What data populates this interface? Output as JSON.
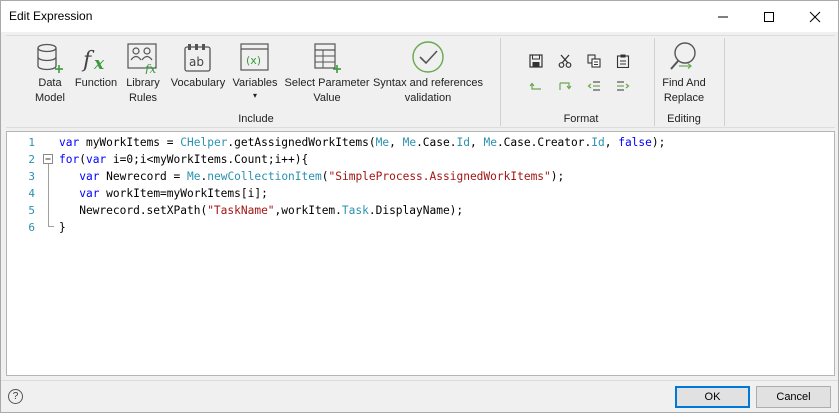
{
  "window": {
    "title": "Edit Expression"
  },
  "ribbon": {
    "include_group": {
      "label": "Include",
      "buttons": [
        {
          "line1": "Data",
          "line2": "Model",
          "icon": "database-icon"
        },
        {
          "line1": "Function",
          "line2": "",
          "icon": "function-fx-icon"
        },
        {
          "line1": "Library",
          "line2": "Rules",
          "icon": "library-rules-icon"
        },
        {
          "line1": "Vocabulary",
          "line2": "",
          "icon": "vocabulary-ab-icon"
        },
        {
          "line1": "Variables",
          "line2": "▾",
          "icon": "variables-x-icon"
        },
        {
          "line1": "Select Parameter",
          "line2": "Value",
          "icon": "parameter-table-icon"
        },
        {
          "line1": "Syntax and references",
          "line2": "validation",
          "icon": "validation-check-icon"
        }
      ]
    },
    "format_group": {
      "label": "Format",
      "icons": [
        "save-icon",
        "cut-icon",
        "copy-icon",
        "paste-icon",
        "undo-icon",
        "redo-icon",
        "outdent-icon",
        "indent-icon"
      ]
    },
    "editing_group": {
      "label": "Editing",
      "find_line1": "Find And",
      "find_line2": "Replace",
      "icon": "find-replace-icon"
    }
  },
  "editor": {
    "line_numbers": [
      "1",
      "2",
      "3",
      "4",
      "5",
      "6"
    ],
    "lines": [
      [
        {
          "t": "var",
          "c": "kw"
        },
        {
          "t": " myWorkItems = ",
          "c": "pl"
        },
        {
          "t": "CHelper",
          "c": "ty"
        },
        {
          "t": ".getAssignedWorkItems(",
          "c": "pl"
        },
        {
          "t": "Me",
          "c": "ty"
        },
        {
          "t": ", ",
          "c": "pl"
        },
        {
          "t": "Me",
          "c": "ty"
        },
        {
          "t": ".Case.",
          "c": "pl"
        },
        {
          "t": "Id",
          "c": "ty"
        },
        {
          "t": ", ",
          "c": "pl"
        },
        {
          "t": "Me",
          "c": "ty"
        },
        {
          "t": ".Case.Creator.",
          "c": "pl"
        },
        {
          "t": "Id",
          "c": "ty"
        },
        {
          "t": ", ",
          "c": "pl"
        },
        {
          "t": "false",
          "c": "kw"
        },
        {
          "t": ");",
          "c": "pl"
        }
      ],
      [
        {
          "t": "for",
          "c": "kw"
        },
        {
          "t": "(",
          "c": "pl"
        },
        {
          "t": "var",
          "c": "kw"
        },
        {
          "t": " i=0;i<myWorkItems.Count;i++){",
          "c": "pl"
        }
      ],
      [
        {
          "t": "   ",
          "c": "pl"
        },
        {
          "t": "var",
          "c": "kw"
        },
        {
          "t": " Newrecord = ",
          "c": "pl"
        },
        {
          "t": "Me",
          "c": "ty"
        },
        {
          "t": ".",
          "c": "pl"
        },
        {
          "t": "newCollectionItem",
          "c": "ty"
        },
        {
          "t": "(",
          "c": "pl"
        },
        {
          "t": "\"SimpleProcess.AssignedWorkItems\"",
          "c": "str"
        },
        {
          "t": ");",
          "c": "pl"
        }
      ],
      [
        {
          "t": "   ",
          "c": "pl"
        },
        {
          "t": "var",
          "c": "kw"
        },
        {
          "t": " workItem=myWorkItems[i];",
          "c": "pl"
        }
      ],
      [
        {
          "t": "   Newrecord.setXPath(",
          "c": "pl"
        },
        {
          "t": "\"TaskName\"",
          "c": "str"
        },
        {
          "t": ",workItem.",
          "c": "pl"
        },
        {
          "t": "Task",
          "c": "ty"
        },
        {
          "t": ".DisplayName);",
          "c": "pl"
        }
      ],
      [
        {
          "t": "}",
          "c": "pl"
        }
      ]
    ]
  },
  "footer": {
    "help_label": "?",
    "ok_label": "OK",
    "cancel_label": "Cancel"
  }
}
